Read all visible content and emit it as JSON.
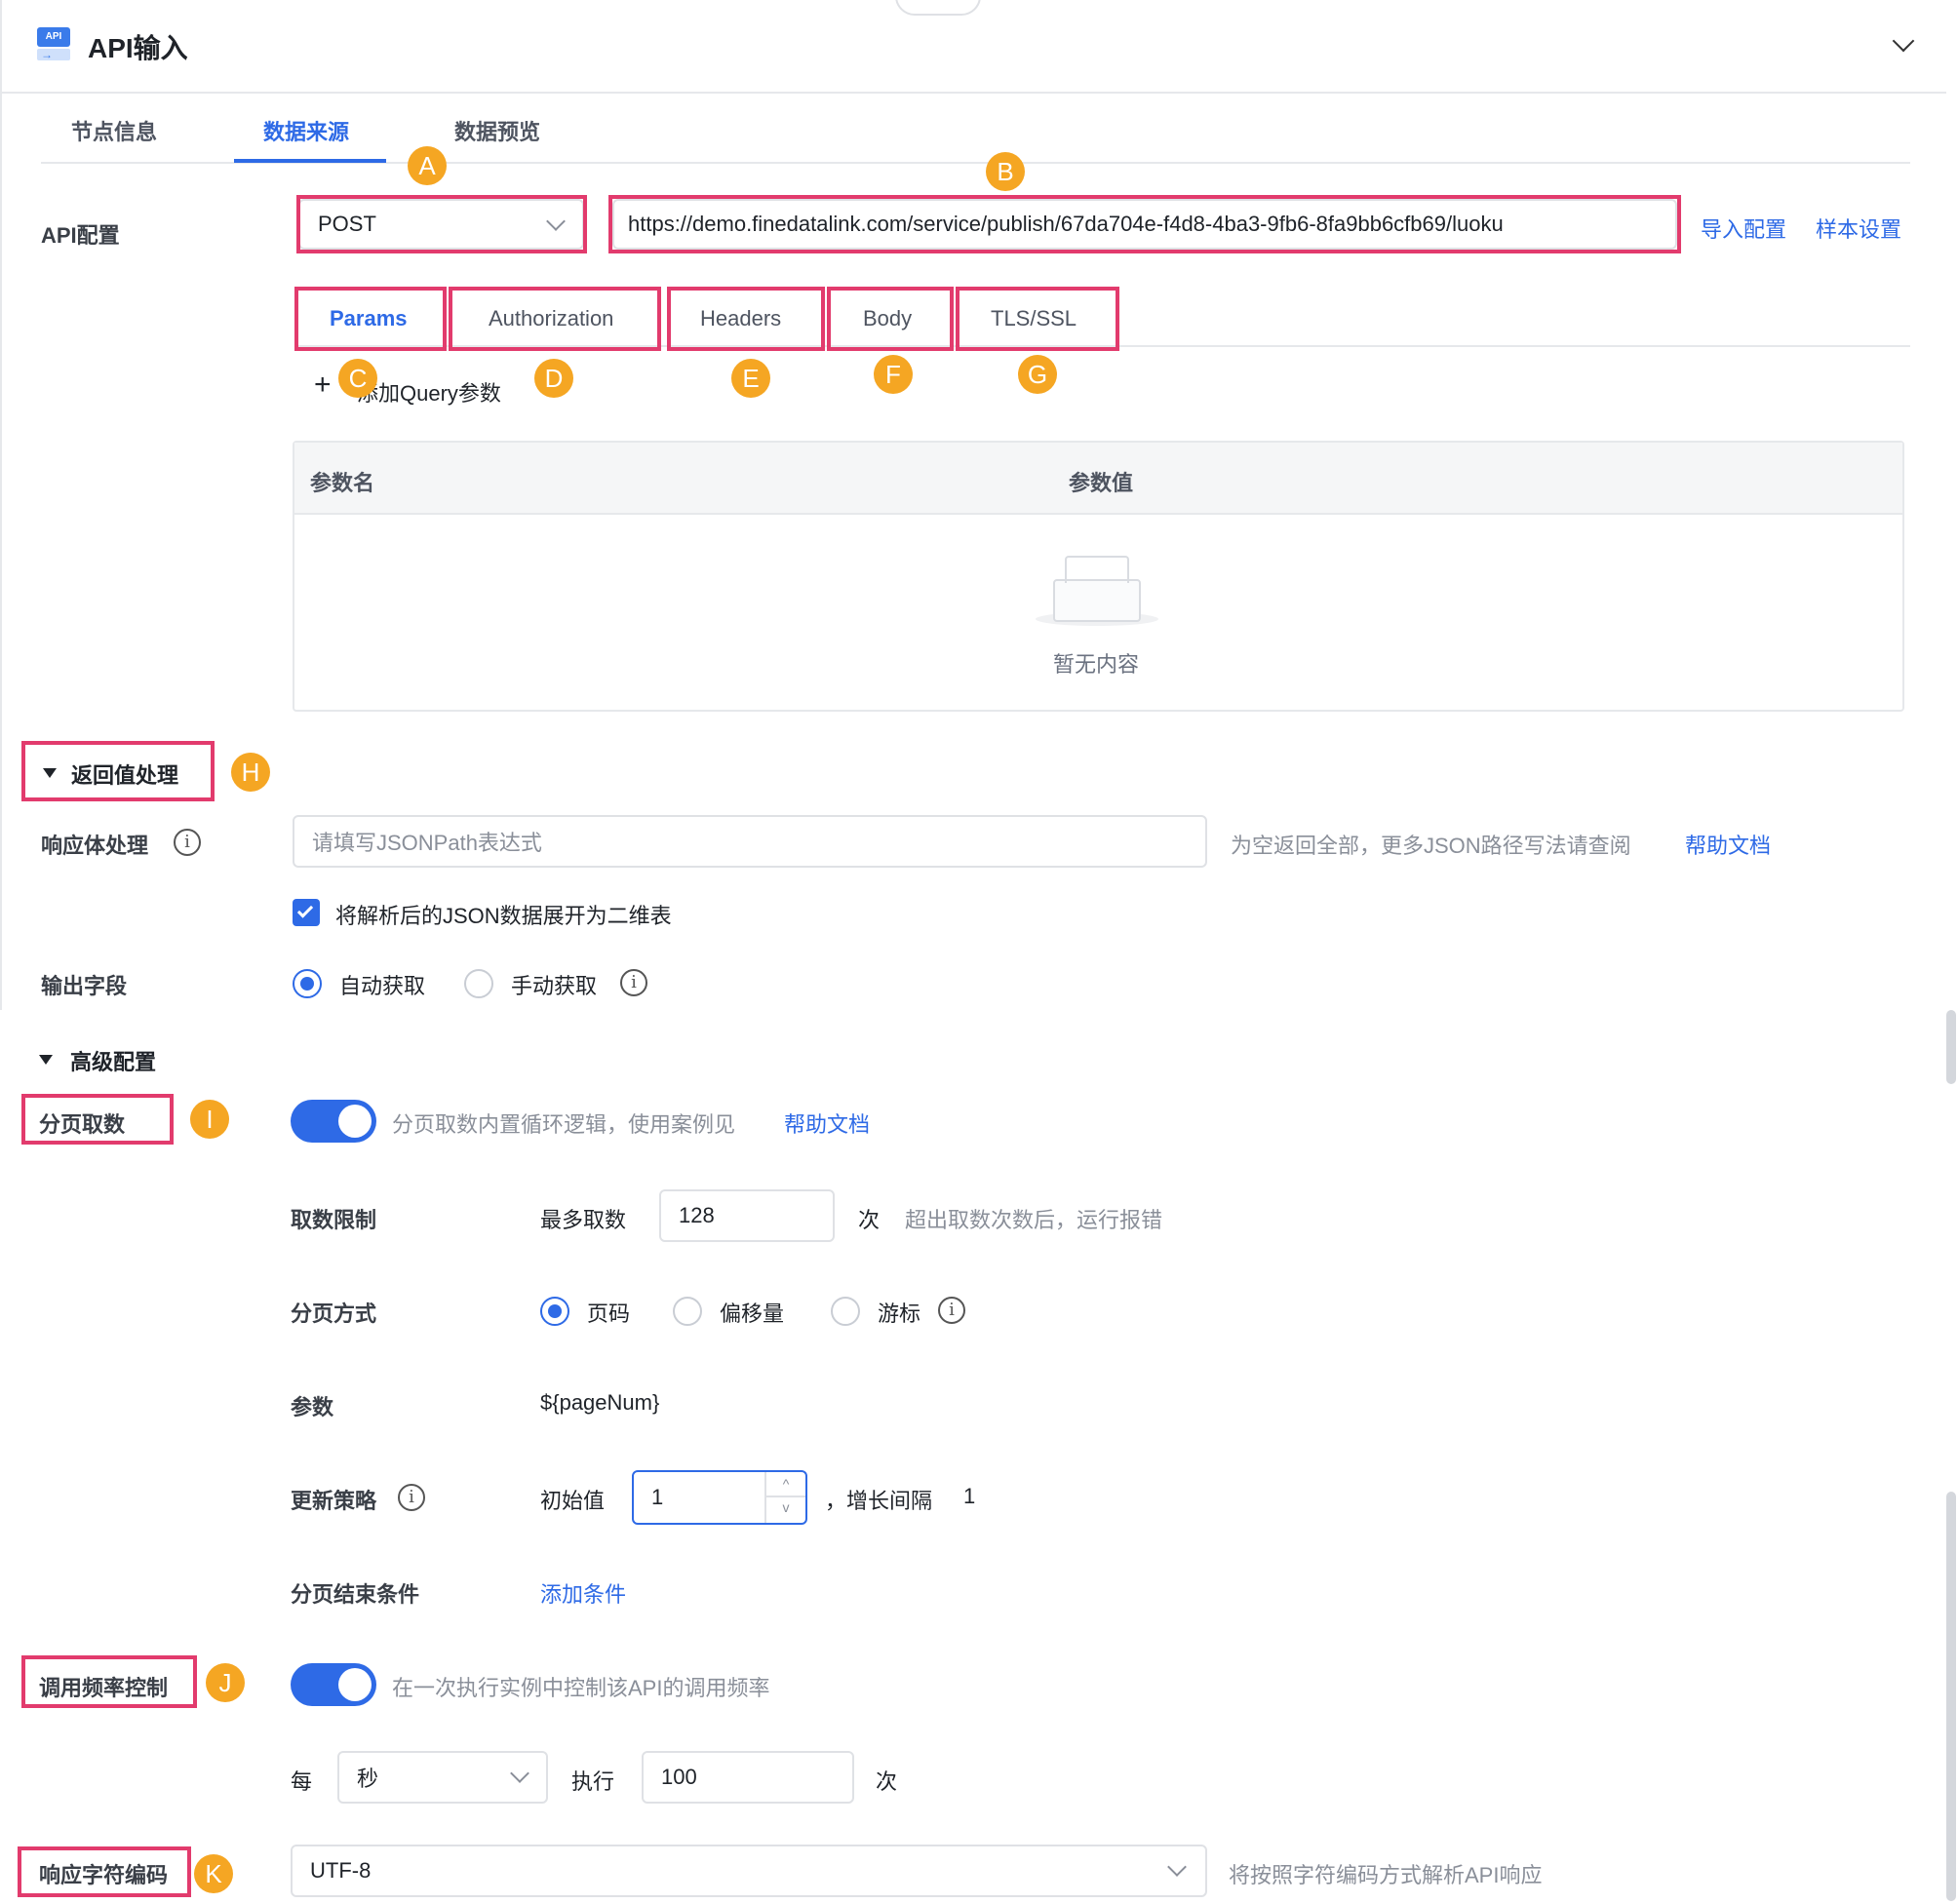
{
  "header": {
    "title": "API输入",
    "icon_badge": "API"
  },
  "tabs": [
    {
      "label": "节点信息"
    },
    {
      "label": "数据来源",
      "active": true
    },
    {
      "label": "数据预览"
    }
  ],
  "api_config": {
    "label": "API配置",
    "method": "POST",
    "url": "https://demo.finedatalink.com/service/publish/67da704e-f4d8-4ba3-9fb6-8fa9bb6cfb69/luoku",
    "import_label": "导入配置",
    "sample_label": "样本设置"
  },
  "request_tabs": [
    "Params",
    "Authorization",
    "Headers",
    "Body",
    "TLS/SSL"
  ],
  "params": {
    "add_label": "添加Query参数",
    "col_name": "参数名",
    "col_value": "参数值",
    "empty_text": "暂无内容"
  },
  "return_section": {
    "title": "返回值处理",
    "response_label": "响应体处理",
    "response_placeholder": "请填写JSONPath表达式",
    "response_hint": "为空返回全部，更多JSON路径写法请查阅",
    "help_link": "帮助文档",
    "flatten_label": "将解析后的JSON数据展开为二维表",
    "output_label": "输出字段",
    "auto_label": "自动获取",
    "manual_label": "手动获取"
  },
  "advanced": {
    "title": "高级配置",
    "paging_label": "分页取数",
    "paging_hint": "分页取数内置循环逻辑，使用案例见",
    "paging_help": "帮助文档",
    "limit_label": "取数限制",
    "max_label": "最多取数",
    "max_value": "128",
    "times_unit": "次",
    "limit_hint": "超出取数次数后，运行报错",
    "mode_label": "分页方式",
    "mode_page": "页码",
    "mode_offset": "偏移量",
    "mode_cursor": "游标",
    "param_label": "参数",
    "param_value": "${pageNum}",
    "update_label": "更新策略",
    "init_label": "初始值",
    "init_value": "1",
    "step_label": "，增长间隔",
    "step_value": "1",
    "end_label": "分页结束条件",
    "end_add": "添加条件",
    "rate_label": "调用频率控制",
    "rate_hint": "在一次执行实例中控制该API的调用频率",
    "per_label": "每",
    "per_unit": "秒",
    "exec_label": "执行",
    "exec_value": "100",
    "exec_unit": "次",
    "charset_label": "响应字符编码",
    "charset_value": "UTF-8",
    "charset_hint": "将按照字符编码方式解析API响应"
  },
  "markers": [
    "A",
    "B",
    "C",
    "D",
    "E",
    "F",
    "G",
    "H",
    "I",
    "J",
    "K"
  ],
  "colors": {
    "accent": "#2e6ae6",
    "annotation_box": "#e23b6d",
    "marker": "#f5a623"
  }
}
